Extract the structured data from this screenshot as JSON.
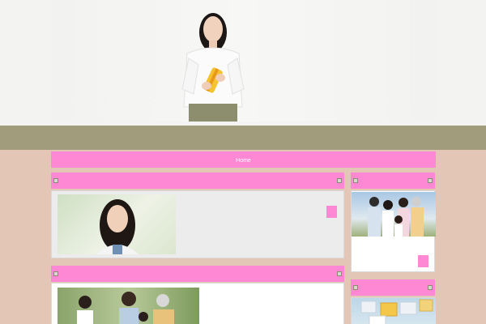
{
  "nav": {
    "items": [
      {
        "label": "Home"
      }
    ]
  },
  "colors": {
    "accent": "#ff88d4",
    "olive": "#a09c7c",
    "background": "#e4c6b6"
  },
  "photos": {
    "hero": "woman-holding-gift-photo",
    "smiling_woman": "smiling-woman-photo",
    "family_small": "family-group-photo",
    "family_large": "family-group-photo",
    "gift_boxes": "gift-boxes-photo"
  }
}
